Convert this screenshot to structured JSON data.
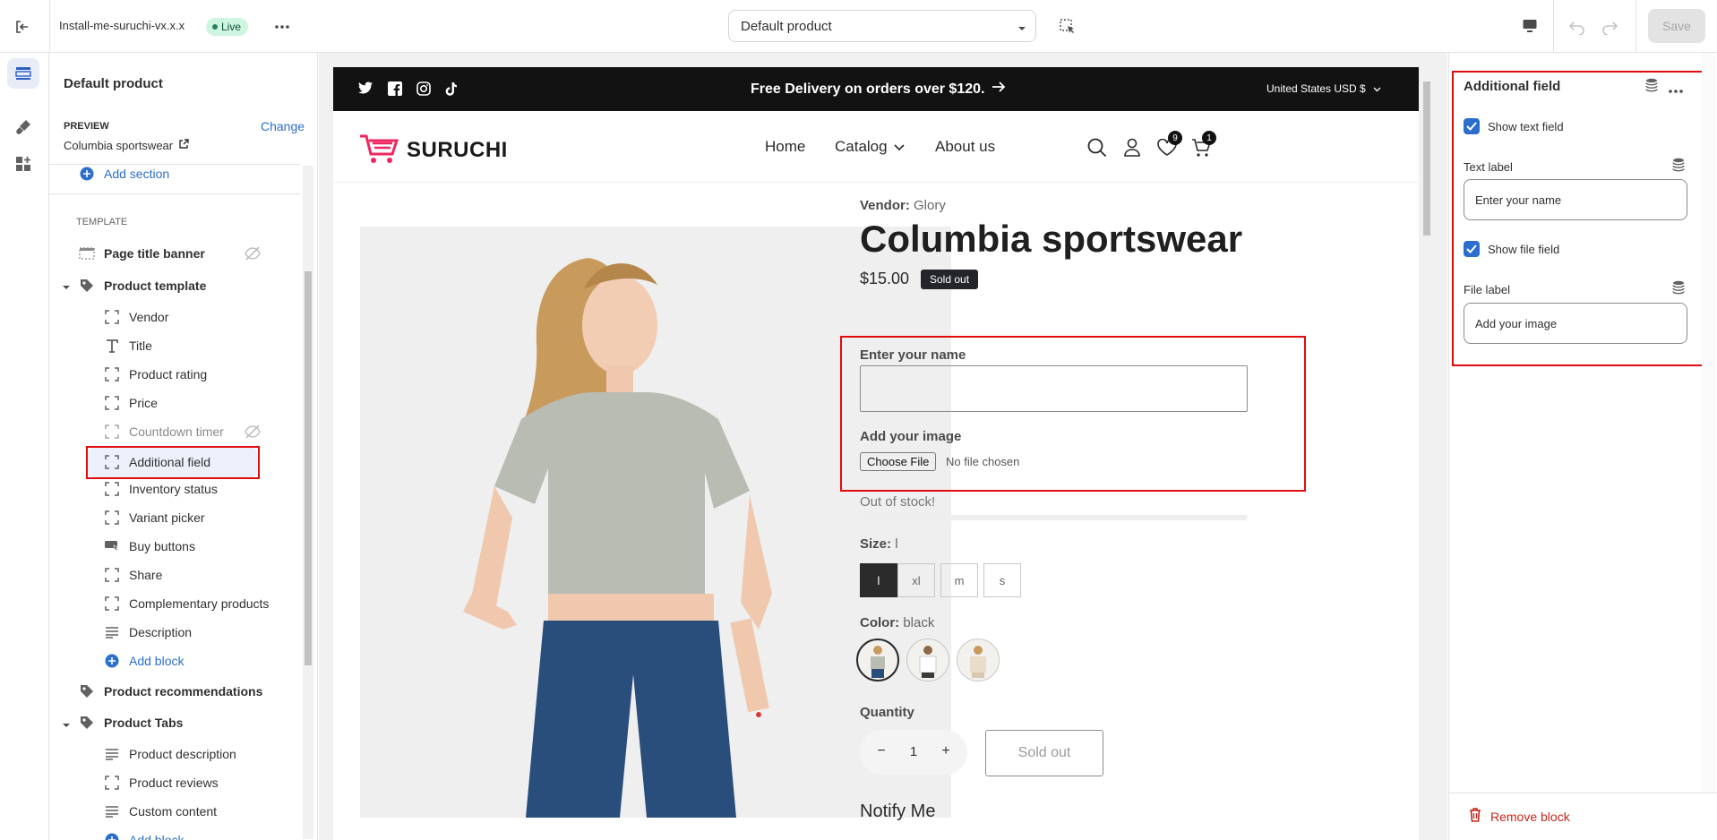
{
  "topbar": {
    "theme_name": "Install-me-suruchi-vx.x.x",
    "live_badge": "Live",
    "template_select": "Default product",
    "save_label": "Save"
  },
  "left": {
    "title": "Default product",
    "preview_label": "PREVIEW",
    "preview_value": "Columbia sportswear",
    "change_label": "Change",
    "add_section": "Add section",
    "template_heading": "TEMPLATE",
    "items": {
      "page_title_banner": "Page title banner",
      "product_template": "Product template",
      "vendor": "Vendor",
      "title": "Title",
      "product_rating": "Product rating",
      "price": "Price",
      "countdown_timer": "Countdown timer",
      "additional_field": "Additional field",
      "inventory_status": "Inventory status",
      "variant_picker": "Variant picker",
      "buy_buttons": "Buy buttons",
      "share": "Share",
      "complementary_products": "Complementary products",
      "description": "Description",
      "add_block": "Add block",
      "product_recommendations": "Product recommendations",
      "product_tabs": "Product Tabs",
      "product_description": "Product description",
      "product_reviews": "Product reviews",
      "custom_content": "Custom content",
      "add_block_2": "Add block"
    }
  },
  "store": {
    "announcement": "Free Delivery on orders over $120.",
    "currency": "United States USD $",
    "logo_text": "SURUCHI",
    "nav": [
      "Home",
      "Catalog",
      "About us"
    ],
    "wishlist_count": "9",
    "cart_count": "1",
    "vendor_label": "Vendor:",
    "vendor_value": "Glory",
    "product_title": "Columbia sportswear",
    "price": "$15.00",
    "sold_out_badge": "Sold out",
    "name_label": "Enter your name",
    "image_label": "Add your image",
    "choose_file": "Choose File",
    "no_file": "No file chosen",
    "stock_status": "Out of stock!",
    "size_label": "Size:",
    "size_value": "l",
    "sizes": [
      "l",
      "xl",
      "m",
      "s"
    ],
    "color_label": "Color:",
    "color_value": "black",
    "quantity_label": "Quantity",
    "quantity_minus": "−",
    "quantity_value": "1",
    "quantity_plus": "+",
    "sold_out_button": "Sold out",
    "notify_me": "Notify Me"
  },
  "right": {
    "title": "Additional field",
    "show_text_field": "Show text field",
    "text_label": "Text label",
    "text_label_value": "Enter your name",
    "show_file_field": "Show file field",
    "file_label": "File label",
    "file_label_value": "Add your image",
    "remove_block": "Remove block"
  },
  "colors": {
    "accent_blue": "#2c6ecb",
    "highlight_red": "#e10b0b",
    "brand_pink": "#ee2761",
    "announcement_bg": "#121212"
  }
}
